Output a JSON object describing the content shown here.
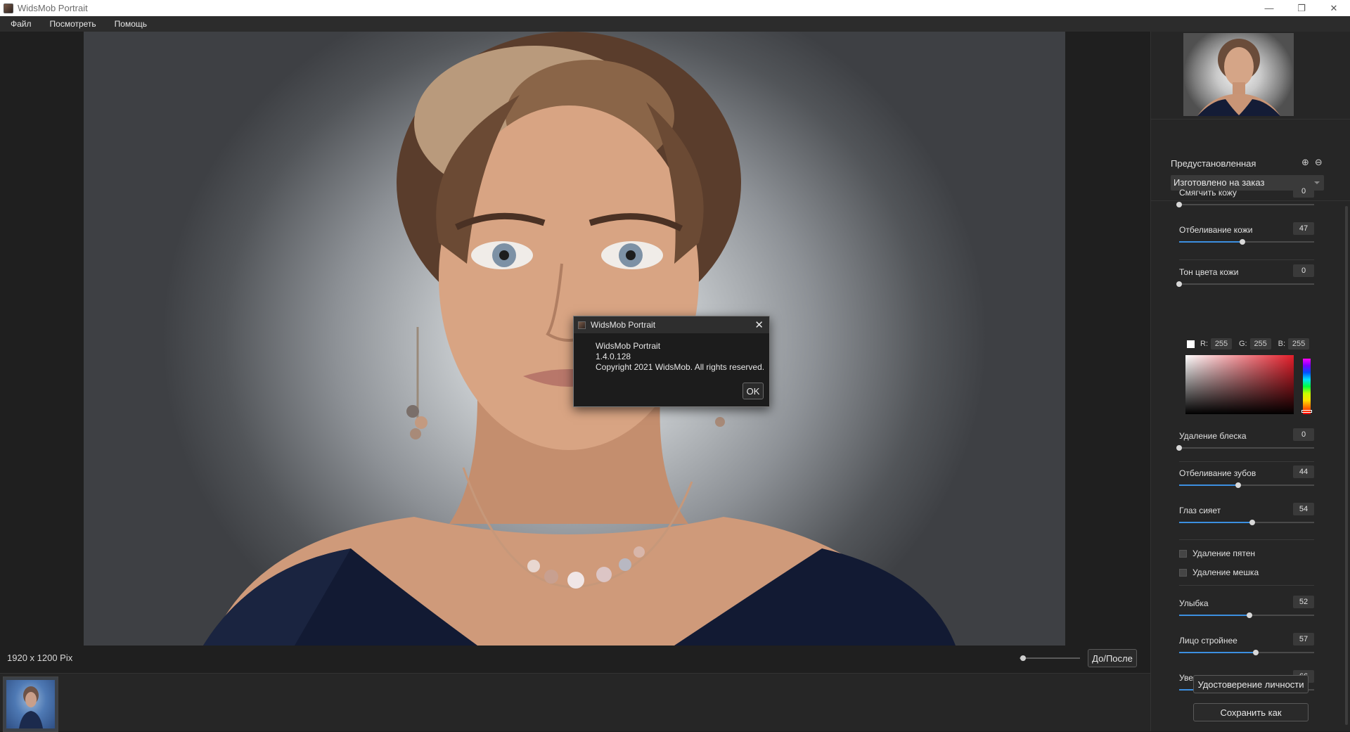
{
  "window": {
    "title": "WidsMob Portrait",
    "minimize": "—",
    "restore": "❐",
    "close": "✕"
  },
  "menu": {
    "items": [
      "Файл",
      "Посмотреть",
      "Помощь"
    ]
  },
  "status": {
    "dimensions": "1920 x 1200 Pix",
    "before_after_label": "До/После",
    "zoom_fraction": 0.05
  },
  "panel": {
    "preset": {
      "label": "Предустановленная",
      "add_icon": "⊕",
      "remove_icon": "⊖",
      "selected": "Изготовлено на заказ"
    },
    "sliders": [
      {
        "label": "Смягчить кожу",
        "value": "0"
      },
      {
        "label": "Отбеливание кожи",
        "value": "47"
      },
      {
        "label": "Тон цвета кожи",
        "value": "0"
      },
      {
        "label": "Удаление блеска",
        "value": "0"
      },
      {
        "label": "Отбеливание зубов",
        "value": "44"
      },
      {
        "label": "Глаз сияет",
        "value": "54"
      },
      {
        "label": "Улыбка",
        "value": "52"
      },
      {
        "label": "Лицо стройнее",
        "value": "57"
      },
      {
        "label": "Увеличение глаз",
        "value": "66"
      }
    ],
    "rgb": {
      "r_label": "R:",
      "r": "255",
      "g_label": "G:",
      "g": "255",
      "b_label": "B:",
      "b": "255"
    },
    "checkboxes": [
      {
        "label": "Удаление пятен",
        "checked": false
      },
      {
        "label": "Удаление мешка",
        "checked": false
      }
    ],
    "identity_button": "Удостоверение личности",
    "save_button": "Сохранить как"
  },
  "dialog": {
    "title": "WidsMob Portrait",
    "close_icon": "✕",
    "app_name": "WidsMob Portrait",
    "version": "1.4.0.128",
    "copyright": "Copyright 2021 WidsMob. All rights reserved.",
    "ok": "OK"
  },
  "colors": {
    "accent": "#3c8fe0",
    "panel_bg": "#262626",
    "canvas_bg": "#1f1f1f"
  }
}
